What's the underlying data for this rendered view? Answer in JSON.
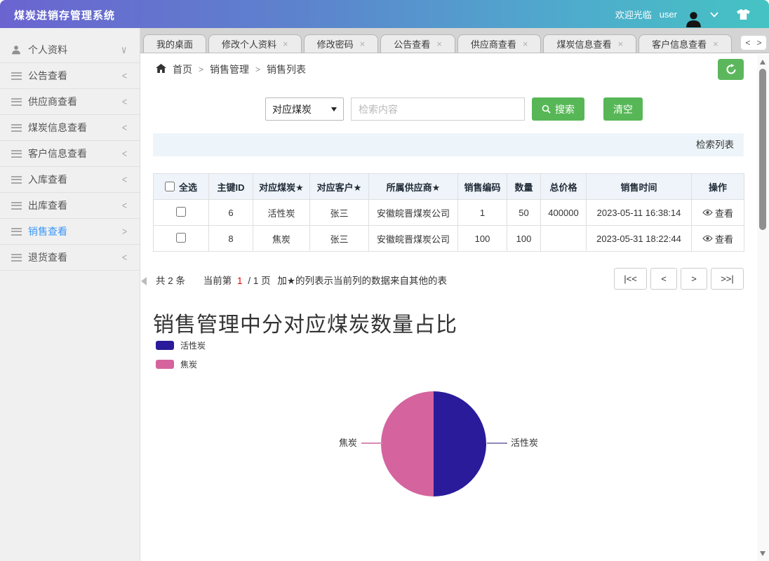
{
  "topbar": {
    "title": "煤炭进销存管理系统",
    "welcome": "欢迎光临",
    "username": "user"
  },
  "sidebar": {
    "items": [
      {
        "label": "个人资料",
        "arrow": "∨",
        "active": false
      },
      {
        "label": "公告查看",
        "arrow": "<",
        "active": false
      },
      {
        "label": "供应商查看",
        "arrow": "<",
        "active": false
      },
      {
        "label": "煤炭信息查看",
        "arrow": "<",
        "active": false
      },
      {
        "label": "客户信息查看",
        "arrow": "<",
        "active": false
      },
      {
        "label": "入库查看",
        "arrow": "<",
        "active": false
      },
      {
        "label": "出库查看",
        "arrow": "<",
        "active": false
      },
      {
        "label": "销售查看",
        "arrow": ">",
        "active": true
      },
      {
        "label": "退货查看",
        "arrow": "<",
        "active": false
      }
    ]
  },
  "tabs": {
    "items": [
      {
        "label": "我的桌面"
      },
      {
        "label": "修改个人资料"
      },
      {
        "label": "修改密码"
      },
      {
        "label": "公告查看"
      },
      {
        "label": "供应商查看"
      },
      {
        "label": "煤炭信息查看"
      },
      {
        "label": "客户信息查看"
      }
    ],
    "scroll_prev": "<",
    "scroll_next": ">"
  },
  "icons": {
    "close": "×"
  },
  "breadcrumb": {
    "items": [
      "首页",
      "销售管理",
      "销售列表"
    ],
    "separator": ">"
  },
  "search": {
    "field_selected": "对应煤炭",
    "placeholder": "检索内容",
    "search_label": "搜索",
    "clear_label": "清空"
  },
  "list_header": "检索列表",
  "table": {
    "headers": [
      "全选",
      "主键ID",
      "对应煤炭★",
      "对应客户★",
      "所属供应商★",
      "销售编码",
      "数量",
      "总价格",
      "销售时间",
      "操作"
    ],
    "rows": [
      {
        "cells": [
          "6",
          "活性炭",
          "张三",
          "安徽皖晋煤炭公司",
          "1",
          "50",
          "400000",
          "2023-05-11 16:38:14"
        ],
        "action": "查看"
      },
      {
        "cells": [
          "8",
          "焦炭",
          "张三",
          "安徽皖晋煤炭公司",
          "100",
          "100",
          "",
          "2023-05-31 18:22:44"
        ],
        "action": "查看"
      }
    ]
  },
  "pagination": {
    "count_text": "共 2 条",
    "page_prefix": "当前第",
    "page_current": "1",
    "page_suffix": "/ 1 页",
    "note": "加★的列表示当前列的数据来自其他的表",
    "first_label": "|<<",
    "prev_label": "<",
    "next_label": ">",
    "last_label": ">>|"
  },
  "chart_data": {
    "type": "pie",
    "title": "销售管理中分对应煤炭数量占比",
    "labels": [
      "活性炭",
      "焦炭"
    ],
    "values": [
      50,
      50
    ],
    "unit": "percent",
    "colors": [
      "#2a1b9a",
      "#d5639e"
    ],
    "legend_position": "top-left"
  },
  "theme": {
    "accent_green": "#5cb75c",
    "active_blue": "#3b97f7",
    "page_number_red": "#e60000"
  }
}
